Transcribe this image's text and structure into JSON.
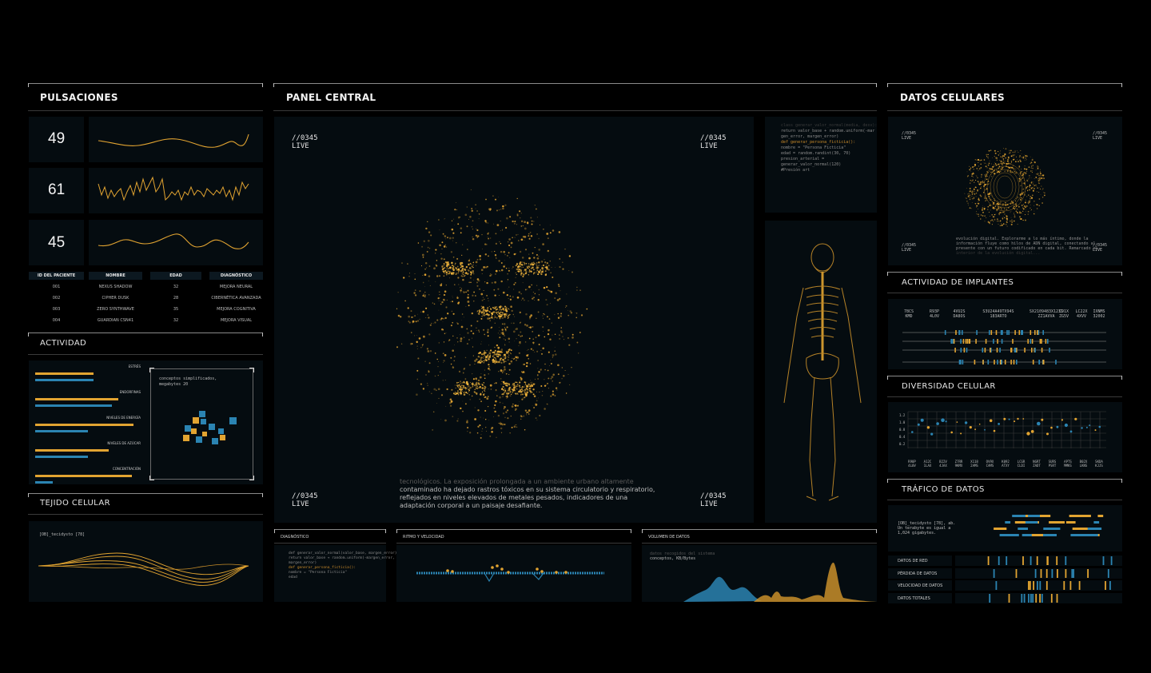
{
  "colors": {
    "accent": "#e2a431",
    "blue": "#2b84b2",
    "panel": "#050c10",
    "line": "#8a8a8a"
  },
  "left": {
    "pulse_title": "PULSACIONES",
    "pulses": [
      {
        "value": "49"
      },
      {
        "value": "61"
      },
      {
        "value": "45"
      }
    ],
    "table": {
      "headers": [
        "ID DEL PACIENTE",
        "NOMBRE",
        "EDAD",
        "DIAGNÓSTICO"
      ],
      "rows": [
        [
          "001",
          "NEXUS SHADOW",
          "32",
          "MEJORA NEURAL"
        ],
        [
          "002",
          "CIPHER DUSK",
          "28",
          "CIBERNÉTICA AVANZADA"
        ],
        [
          "003",
          "ZERO SYNTHWAVE",
          "35",
          "MEJORA COGNITIVA"
        ],
        [
          "004",
          "GUARDIAN CSN41",
          "32",
          "MEJORA VISUAL"
        ]
      ]
    },
    "activity_title": "ACTIVIDAD",
    "bars": [
      {
        "label": "ESTRÉS",
        "orange": 0.55,
        "blue": 0.55
      },
      {
        "label": "ENDORFINAS",
        "orange": 0.79,
        "blue": 0.73
      },
      {
        "label": "NIVELES DE ENERGÍA",
        "orange": 0.93,
        "blue": 0.5
      },
      {
        "label": "NIVELES DE AZÚCAR",
        "orange": 0.7,
        "blue": 0.5
      },
      {
        "label": "CONCENTRACIÓN",
        "orange": 0.92,
        "blue": 0.17
      }
    ],
    "activity_note": [
      "conceptos simplificados,",
      "megabytes 20"
    ],
    "tissue_title": "TEJIDO CELULAR",
    "tissue_note": "[OB]_tecidysto [78]"
  },
  "center": {
    "title": "PANEL CENTRAL",
    "corner_code": "//0345",
    "corner_live": "LIVE",
    "narrative": [
      "tecnológicos. La exposición prolongada a un ambiente urbano altamente",
      "contaminado ha dejado rastros tóxicos en su sistema circulatorio y respiratorio,",
      "reflejados en niveles elevados de metales pesados, indicadores de una",
      "adaptación corporal a un paisaje desafiante."
    ],
    "code": [
      {
        "t": "class generar_valor_normal(media, desv):",
        "o": false
      },
      {
        "t": "  return valor_base + random.uniform(-mar",
        "o": false
      },
      {
        "t": "  gen_error, margen_error)",
        "o": false
      },
      {
        "t": "def generar_persona_ficticia():",
        "o": true
      },
      {
        "t": "  nombre = \"Persona Ficticia\"",
        "o": false
      },
      {
        "t": "  edad = random.randint(30, 70)",
        "o": false
      },
      {
        "t": "  presion_arterial =",
        "o": false
      },
      {
        "t": "  generar_valor_normal(120)",
        "o": false
      },
      {
        "t": "  #Presión art",
        "o": false
      }
    ],
    "diag_title": "DIAGNÓSTICO",
    "diag_code": [
      {
        "t": "def generar_valor_normal(valor_base, margen_error):",
        "o": false
      },
      {
        "t": "  return valor_base + random.uniform(-margen_error,",
        "o": false
      },
      {
        "t": "  margen_error)",
        "o": false
      },
      {
        "t": "def generar_persona_ficticia():",
        "o": true
      },
      {
        "t": "  nombre = \"Persona Ficticia\"",
        "o": false
      },
      {
        "t": "  edad",
        "o": false
      }
    ],
    "rhythm_title": "RITMO Y VELOCIDAD",
    "volume_title": "VOLUMEN DE DATOS",
    "volume_note": [
      "datos recogidos del sistema",
      "conceptos, KB/Bytes"
    ]
  },
  "right": {
    "cell_title": "DATOS CELULARES",
    "cell_note": [
      "evolución digital. Explorarme a lo más íntimo, donde la",
      "información fluye como hilos de ADN digital, conectando al",
      "presente con un futuro codificado en cada bit. Remarcado al",
      "interior de la evolución digital..."
    ],
    "implants_title": "ACTIVIDAD DE IMPLANTES",
    "implant_codes": [
      [
        "78CS",
        "KMD"
      ],
      [
        "R93P",
        "4L0V"
      ],
      [
        "4VU2S",
        "DA8OS"
      ],
      [
        "S3U24A49TX94S",
        "183ARTO"
      ],
      [
        "SX2109483X1231",
        "ZZ1AVVA"
      ],
      [
        "C91X",
        "ZG5V"
      ],
      [
        "LC22X",
        "4XVV"
      ],
      [
        "IXNMS",
        "32002"
      ]
    ],
    "diversity_title": "DIVERSIDAD CELULAR",
    "diversity_y": [
      "1.2",
      "1.0",
      "0.8",
      "0.4",
      "0.2"
    ],
    "diversity_codes": [
      [
        "R90P",
        "4L0V"
      ],
      [
        "A12C",
        "1LAX"
      ],
      [
        "B22V",
        "4JAX"
      ],
      [
        "Z7RR",
        "9KMX"
      ],
      [
        "X118",
        "2AMS"
      ],
      [
        "OV9X",
        "CAMS"
      ],
      [
        "K092",
        "ATXY"
      ],
      [
        "LCGR",
        "CLDI"
      ],
      [
        "NGRT",
        "ZADT"
      ],
      [
        "SURS",
        "PSRT"
      ],
      [
        "APTS",
        "MMKS"
      ],
      [
        "B02X",
        "LKNS"
      ],
      [
        "SKDA",
        "KJJS"
      ]
    ],
    "traffic_title": "TRÁFICO DE DATOS",
    "traffic_note": [
      "[OB]_tecidysto [78], ab.",
      "Un terabyte es igual a",
      "1,024 gigabytes."
    ],
    "traffic_rows": [
      "DATOS DE RED",
      "PÉRDIDA DE DATOS",
      "VELOCIDAD DE DATOS",
      "DATOS TOTALES"
    ]
  }
}
